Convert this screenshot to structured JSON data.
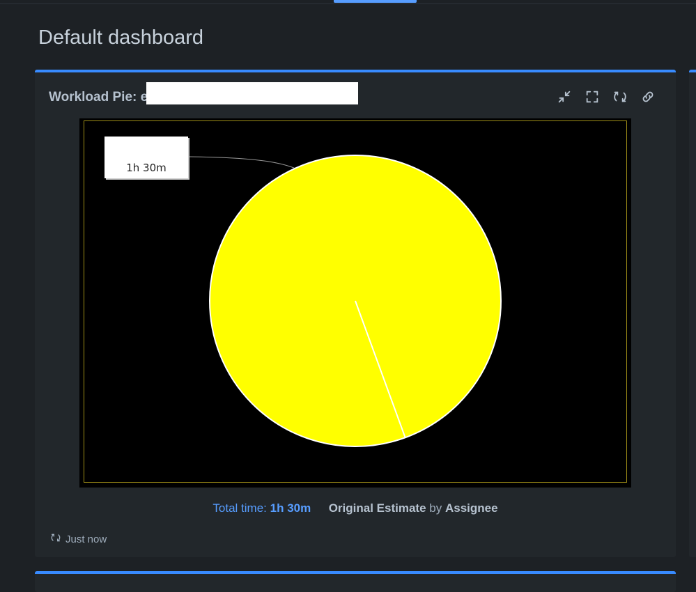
{
  "page": {
    "title": "Default dashboard"
  },
  "gadget": {
    "title": "Workload Pie: e",
    "toolbar": {
      "minimize_icon": "minimize-icon",
      "fullscreen_icon": "fullscreen-icon",
      "refresh_icon": "refresh-icon",
      "link_icon": "link-icon"
    },
    "summary": {
      "total_label": "Total time:",
      "total_value": "1h 30m",
      "field": "Original Estimate",
      "by": "by",
      "group": "Assignee"
    },
    "status": {
      "icon": "refresh-icon",
      "text": "Just now"
    }
  },
  "colors": {
    "accent": "#388bff",
    "slice": "#ffff00",
    "chart_background": "#000000"
  },
  "chart_data": {
    "type": "pie",
    "slices": [
      {
        "label": "",
        "value_text": "1h 30m",
        "value": 1.0,
        "color": "#ffff00"
      }
    ]
  }
}
